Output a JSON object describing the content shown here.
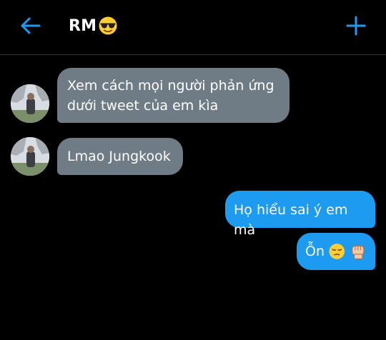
{
  "header": {
    "title": "RM",
    "title_emoji": "smiling-face-with-sunglasses",
    "back_icon": "arrow-left-icon",
    "add_icon": "plus-icon"
  },
  "colors": {
    "accent": "#1d9bf0",
    "incoming_bubble": "#6f7c86",
    "background": "#000000"
  },
  "messages": [
    {
      "direction": "incoming",
      "text_line1": "Xem cách mọi người phản ứng",
      "text_line2": "dưới tweet của em kìa"
    },
    {
      "direction": "incoming",
      "text": "Lmao Jungkook"
    },
    {
      "direction": "outgoing",
      "text": "Họ hiểu sai ý em mà"
    },
    {
      "direction": "outgoing",
      "text": "Ỗn",
      "emojis": [
        "pensive-face",
        "raised-fist"
      ]
    }
  ]
}
